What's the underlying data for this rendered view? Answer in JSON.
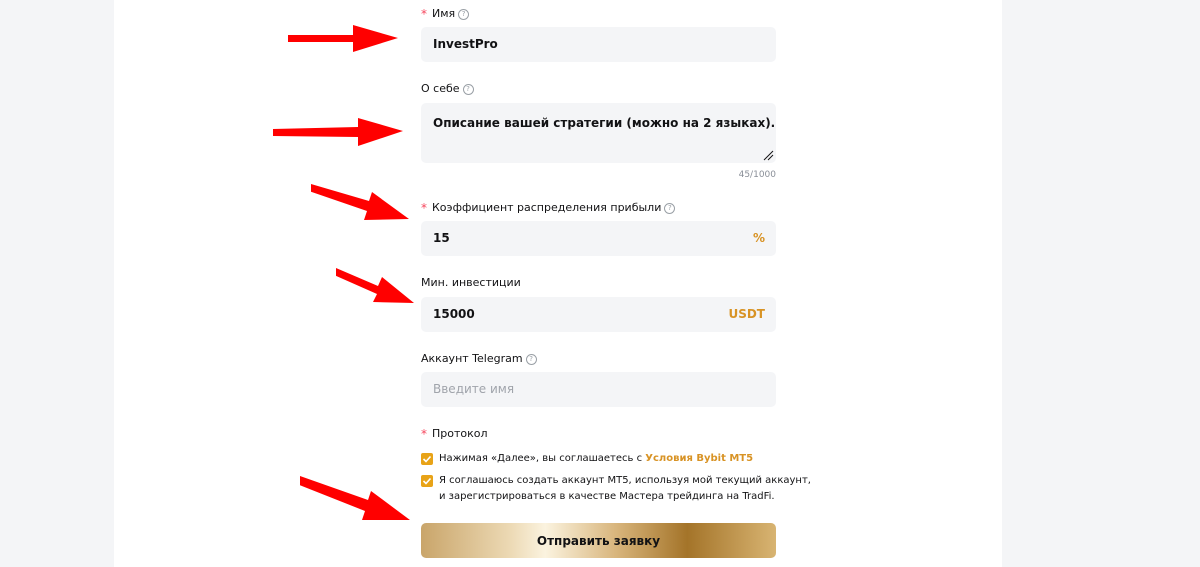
{
  "form": {
    "name": {
      "label": "Имя",
      "required": true,
      "value": "InvestPro"
    },
    "about": {
      "label": "О себе",
      "value": "Описание вашей стратегии (можно на 2 языках).",
      "counter": "45/1000"
    },
    "profit_share": {
      "label": "Коэффициент распределения прибыли",
      "required": true,
      "value": "15",
      "unit": "%"
    },
    "min_investment": {
      "label": "Мин. инвестиции",
      "value": "15000",
      "unit": "USDT"
    },
    "telegram": {
      "label": "Аккаунт Telegram",
      "placeholder": "Введите имя"
    },
    "protocol": {
      "label": "Протокол",
      "required": true,
      "agree_terms_prefix": "Нажимая «Далее», вы соглашаетесь с",
      "agree_terms_link": "Условия Bybit MT5",
      "agree_mt5_line1": "Я соглашаюсь создать аккаунт MT5, используя мой текущий аккаунт,",
      "agree_mt5_line2": "и зарегистрироваться в качестве Мастера трейдинга на TradFi.",
      "agree_terms_checked": true,
      "agree_mt5_checked": true
    },
    "submit_label": "Отправить заявку"
  },
  "colors": {
    "accent": "#d89325",
    "checkbox": "#e8a317",
    "required_star": "#f6465d",
    "field_bg": "#f4f5f7",
    "arrow": "#ff0000"
  }
}
